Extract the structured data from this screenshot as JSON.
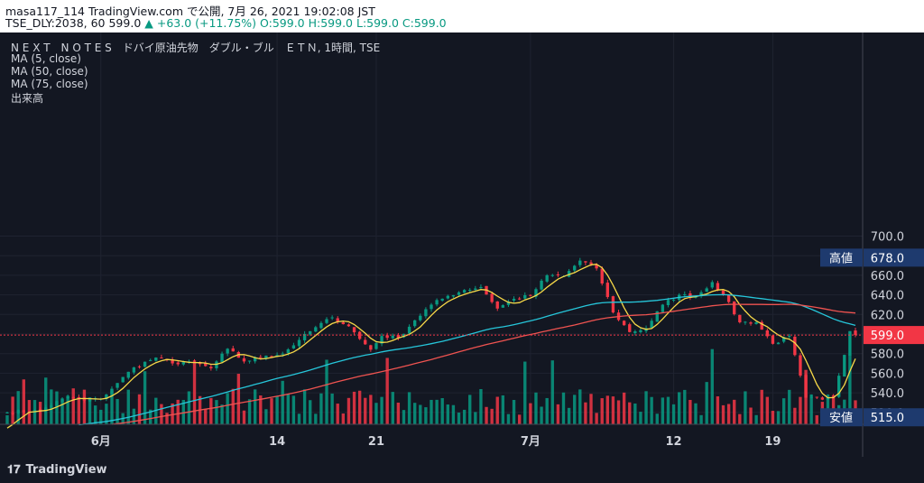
{
  "header": {
    "line1": "masa117_114 TradingView.com で公開, 7月 26, 2021 19:02:08 JST",
    "symbol": "TSE_DLY:2038, 60",
    "price": "599.0",
    "change": "▲ +63.0 (+11.75%)",
    "ohlc": "O:599.0 H:599.0 L:599.0 C:599.0"
  },
  "legend": {
    "title": "N E X T　N O T E S　ドバイ原油先物　ダブル・ブル　ＥＴＮ, 1時間, TSE",
    "ma5": "MA (5, close)",
    "ma50": "MA (50, close)",
    "ma75": "MA (75, close)",
    "volume": "出来高"
  },
  "footer": {
    "brand": "TradingView",
    "brand_mark": "𝟏𝟕"
  },
  "chart_data": {
    "type": "candlestick",
    "y_ticks": [
      520,
      540,
      560,
      580,
      600,
      620,
      640,
      660,
      680,
      700
    ],
    "y_tick_labels": [
      "520.0",
      "540.0",
      "560.0",
      "580.0",
      "600.0",
      "620.0",
      "640.0",
      "660.0",
      "680.0",
      "700.0"
    ],
    "x_labels": [
      {
        "label": "6月",
        "index": 17
      },
      {
        "label": "14",
        "index": 49
      },
      {
        "label": "21",
        "index": 67
      },
      {
        "label": "7月",
        "index": 95
      },
      {
        "label": "12",
        "index": 121
      },
      {
        "label": "19",
        "index": 139
      }
    ],
    "bar_count": 155,
    "current_price": {
      "value": 599.0,
      "label": "599.0"
    },
    "high": {
      "value": 678.0,
      "name": "高値",
      "label": "678.0"
    },
    "low": {
      "value": 515.0,
      "name": "安値",
      "label": "515.0"
    },
    "close_path": [
      [
        0,
        520
      ],
      [
        6,
        522
      ],
      [
        11,
        536
      ],
      [
        14,
        532
      ],
      [
        17,
        534
      ],
      [
        20,
        550
      ],
      [
        23,
        566
      ],
      [
        27,
        576
      ],
      [
        30,
        570
      ],
      [
        33,
        572
      ],
      [
        37,
        565
      ],
      [
        40,
        585
      ],
      [
        43,
        572
      ],
      [
        47,
        578
      ],
      [
        50,
        580
      ],
      [
        53,
        594
      ],
      [
        56,
        607
      ],
      [
        59,
        617
      ],
      [
        62,
        608
      ],
      [
        64,
        595
      ],
      [
        66,
        584
      ],
      [
        68,
        598
      ],
      [
        71,
        596
      ],
      [
        74,
        614
      ],
      [
        77,
        630
      ],
      [
        80,
        639
      ],
      [
        83,
        645
      ],
      [
        86,
        648
      ],
      [
        89,
        626
      ],
      [
        92,
        636
      ],
      [
        95,
        639
      ],
      [
        98,
        660
      ],
      [
        101,
        659
      ],
      [
        104,
        675
      ],
      [
        107,
        667
      ],
      [
        110,
        622
      ],
      [
        113,
        602
      ],
      [
        116,
        606
      ],
      [
        119,
        630
      ],
      [
        122,
        640
      ],
      [
        125,
        638
      ],
      [
        128,
        653
      ],
      [
        130,
        640
      ],
      [
        133,
        612
      ],
      [
        136,
        612
      ],
      [
        139,
        590
      ],
      [
        142,
        598
      ],
      [
        145,
        535
      ],
      [
        148,
        533
      ],
      [
        150,
        536
      ],
      [
        153,
        603
      ],
      [
        154,
        599
      ]
    ],
    "ma_series": [
      {
        "key": "ma5",
        "color": "#f6d848"
      },
      {
        "key": "ma50",
        "color": "#26c6da"
      },
      {
        "key": "ma75",
        "color": "#ef5350"
      }
    ],
    "up_color": "#089981",
    "down_color": "#f23645"
  }
}
